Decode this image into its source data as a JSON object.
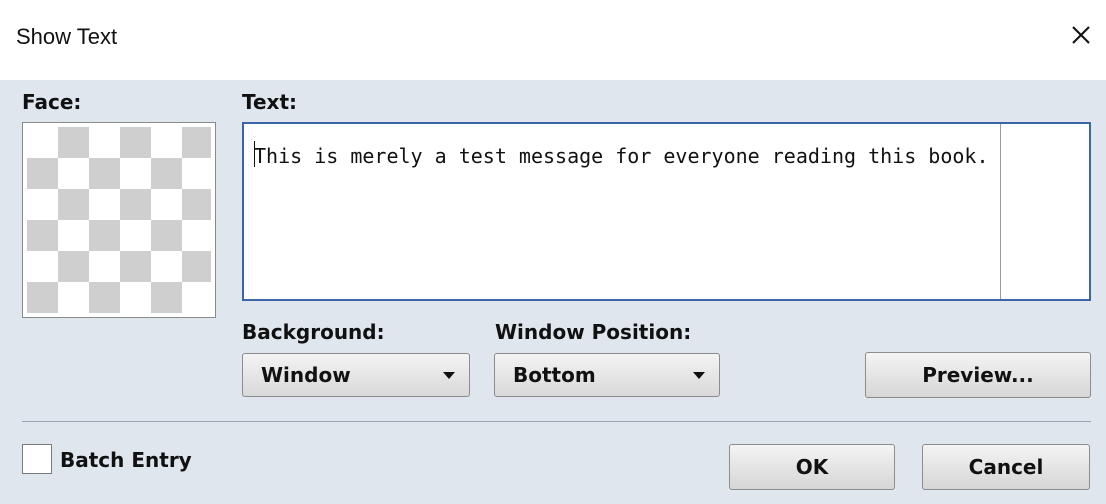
{
  "window": {
    "title": "Show Text",
    "close_icon": "close-icon"
  },
  "labels": {
    "face": "Face:",
    "text": "Text:",
    "background": "Background:",
    "window_position": "Window Position:"
  },
  "text_area": {
    "value": "This is merely a test message for everyone reading this book."
  },
  "face_preview": {
    "pattern": "checkerboard-transparent"
  },
  "background_select": {
    "value": "Window"
  },
  "window_position_select": {
    "value": "Bottom"
  },
  "buttons": {
    "preview": "Preview...",
    "ok": "OK",
    "cancel": "Cancel"
  },
  "batch_entry": {
    "label": "Batch Entry",
    "checked": false
  },
  "colors": {
    "dialog_bg": "#dfe6ee",
    "textarea_border": "#3a66a8"
  }
}
